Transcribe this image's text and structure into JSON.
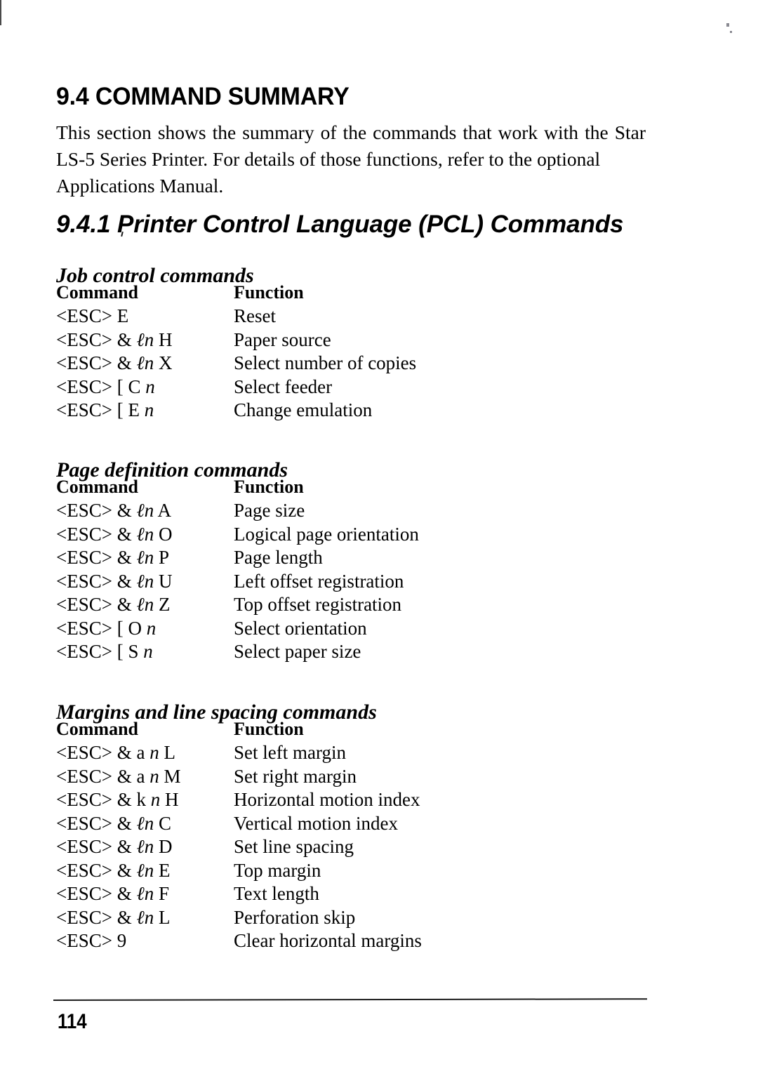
{
  "page": {
    "section_number_title": "9.4 COMMAND SUMMARY",
    "intro_line1": "This section shows the summary of the commands that work with the Star",
    "intro_line2": "LS-5 Series Printer. For details of those functions, refer to the optional",
    "intro_line3": "Applications Manual.",
    "subsection_title": "9.4.1 Printer Control Language (PCL) Commands",
    "page_number": "114"
  },
  "groups": [
    {
      "title": "Job control commands",
      "columns": {
        "command": "Command",
        "function": "Function"
      },
      "rows": [
        {
          "cmd_pre": "<ESC> E",
          "cmd_it": "",
          "cmd_post": "",
          "function": "Reset"
        },
        {
          "cmd_pre": "<ESC> & ",
          "cmd_it": "ℓn",
          "cmd_post": " H",
          "function": "Paper source"
        },
        {
          "cmd_pre": "<ESC> & ",
          "cmd_it": "ℓn",
          "cmd_post": " X",
          "function": "Select number of copies"
        },
        {
          "cmd_pre": "<ESC> [ C ",
          "cmd_it": "n",
          "cmd_post": "",
          "function": "Select feeder"
        },
        {
          "cmd_pre": "<ESC> [ E ",
          "cmd_it": "n",
          "cmd_post": "",
          "function": "Change emulation"
        }
      ]
    },
    {
      "title": "Page definition commands",
      "columns": {
        "command": "Command",
        "function": "Function"
      },
      "rows": [
        {
          "cmd_pre": "<ESC> & ",
          "cmd_it": "ℓn",
          "cmd_post": " A",
          "function": "Page size"
        },
        {
          "cmd_pre": "<ESC> & ",
          "cmd_it": "ℓn",
          "cmd_post": " O",
          "function": "Logical page orientation"
        },
        {
          "cmd_pre": "<ESC> & ",
          "cmd_it": "ℓn",
          "cmd_post": " P",
          "function": "Page length"
        },
        {
          "cmd_pre": "<ESC> & ",
          "cmd_it": "ℓn",
          "cmd_post": " U",
          "function": "Left offset registration"
        },
        {
          "cmd_pre": "<ESC> & ",
          "cmd_it": "ℓn",
          "cmd_post": " Z",
          "function": "Top offset registration"
        },
        {
          "cmd_pre": "<ESC> [ O ",
          "cmd_it": "n",
          "cmd_post": "",
          "function": "Select orientation"
        },
        {
          "cmd_pre": "<ESC> [ S ",
          "cmd_it": "n",
          "cmd_post": "",
          "function": "Select paper size"
        }
      ]
    },
    {
      "title": "Margins and line spacing commands",
      "columns": {
        "command": "Command",
        "function": "Function"
      },
      "rows": [
        {
          "cmd_pre": "<ESC> & a ",
          "cmd_it": "n",
          "cmd_post": " L",
          "function": "Set left margin"
        },
        {
          "cmd_pre": "<ESC> & a ",
          "cmd_it": "n",
          "cmd_post": " M",
          "function": "Set right margin"
        },
        {
          "cmd_pre": "<ESC> & k ",
          "cmd_it": "n",
          "cmd_post": " H",
          "function": "Horizontal motion index"
        },
        {
          "cmd_pre": "<ESC> & ",
          "cmd_it": "ℓn",
          "cmd_post": " C",
          "function": "Vertical motion index"
        },
        {
          "cmd_pre": "<ESC> & ",
          "cmd_it": "ℓn",
          "cmd_post": " D",
          "function": "Set line spacing"
        },
        {
          "cmd_pre": "<ESC> & ",
          "cmd_it": "ℓn",
          "cmd_post": " E",
          "function": "Top margin"
        },
        {
          "cmd_pre": "<ESC> & ",
          "cmd_it": "ℓn",
          "cmd_post": " F",
          "function": "Text length"
        },
        {
          "cmd_pre": "<ESC> & ",
          "cmd_it": "ℓn",
          "cmd_post": " L",
          "function": "Perforation skip"
        },
        {
          "cmd_pre": "<ESC> 9",
          "cmd_it": "",
          "cmd_post": "",
          "function": "Clear horizontal margins"
        }
      ]
    }
  ]
}
